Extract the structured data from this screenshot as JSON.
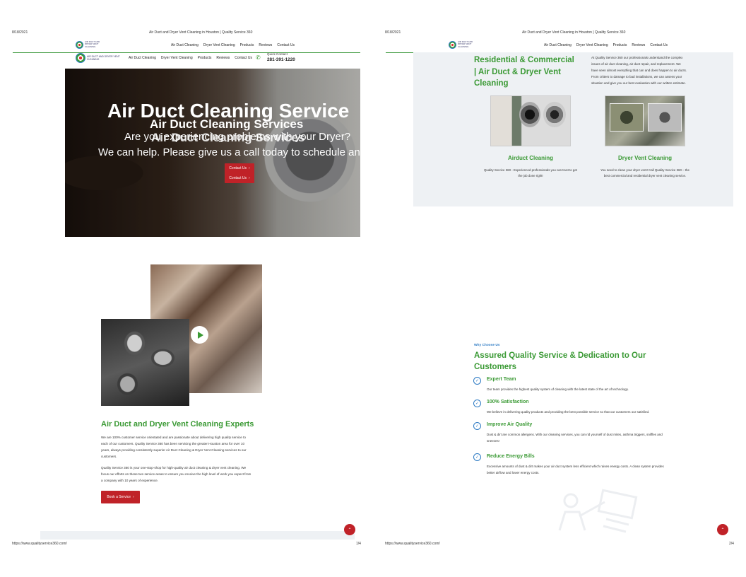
{
  "print": {
    "date": "8/18/2021",
    "title": "Air Duct and Dryer Vent Cleaning in Houston | Quality Service 360",
    "url": "https://www.qualityservice360.com/",
    "page1": "1/4",
    "page2": "2/4"
  },
  "nav": {
    "logo_text": "AIR DUCT AND DRYER VENT CLEANING",
    "links": [
      "Air Duct Cleaning",
      "Dryer Vent Cleaning",
      "Products",
      "Reviews",
      "Contact Us"
    ],
    "quick_contact_label": "Quick Contact",
    "phone": "281-391-1220"
  },
  "hero": {
    "title_large": "Air Duct Cleaning Service",
    "title_small": "Air Duct Cleaning Services",
    "subtitle_line1": "Are you experiencing problems with your Dryer?",
    "subtitle_line2": "We can help. Please give us a call today to schedule an a",
    "button": "Contact Us"
  },
  "about": {
    "title": "Air Duct and Dryer Vent Cleaning Experts",
    "para1_lines": [
      "We are 100% customer service orientated and are passionate about delivering high quality service to",
      "each of our customers. Quality Service 360 has been servicing the greater Houston area for over 10",
      "years, always providing consistently superior Air Duct Cleaning & Dryer Vent Cleaning services to our",
      "customers."
    ],
    "para2_lines": [
      "Quality Service 360 is your one-stop-shop for high-quality air duct cleaning & dryer vent cleaning. We",
      "focus our efforts on these two service areas to ensure you receive the high level of work you expect from",
      "a company with 10 years of experience."
    ],
    "button": "Book a Service"
  },
  "services": {
    "title_lines": [
      "Residential & Commercial",
      "| Air Duct & Dryer Vent",
      "Cleaning"
    ],
    "intro_lines": [
      "At Quality Service 360 our professionals understand the complex",
      "issues of air duct cleaning, air duct repair, and replacement. We",
      "have seen almost everything that can and does happen to air ducts.",
      "From critters to damage to bad installations, we can assess your",
      "situation and give you our best evaluation with our written estimate."
    ],
    "cards": [
      {
        "title": "Airduct Cleaning",
        "lines": [
          "Quality Service 360 - Experienced professionals you can trust to get",
          "the job done right!"
        ]
      },
      {
        "title": "Dryer Vent Cleaning",
        "lines": [
          "You need to clean your dryer vent! Call Quality Service 360 – the",
          "best commercial and residential dryer vent cleaning service."
        ]
      }
    ]
  },
  "why": {
    "eyebrow": "Why Choose Us",
    "title_lines": [
      "Assured Quality Service & Dedication to Our",
      "Customers"
    ],
    "features": [
      {
        "title": "Expert Team",
        "lines": [
          "Our team provides the highest quality system of cleaning with the latest state of the art of technology."
        ]
      },
      {
        "title": "100% Satisfaction",
        "lines": [
          "We believe in delivering quality products and providing the best possible service so that our customers our satisfied."
        ]
      },
      {
        "title": "Improve Air Quality",
        "lines": [
          "Dust & dirt are common allergens. With our cleaning services, you can rid yourself of dust mites, asthma triggers, sniffles and",
          "sneezes!"
        ]
      },
      {
        "title": "Reduce Energy Bills",
        "lines": [
          "Excessive amounts of dust & dirt makes your air duct system less efficient which raises energy costs. A clean system provides",
          "better airflow and lower energy costs."
        ]
      }
    ]
  },
  "icons": {
    "check": "check-circle-icon",
    "play": "play-icon",
    "chevron_up": "chevron-up-icon",
    "phone": "phone-icon"
  },
  "colors": {
    "brand_green": "#3b9a35",
    "brand_red": "#c02228",
    "brand_blue": "#2e7bc4"
  }
}
